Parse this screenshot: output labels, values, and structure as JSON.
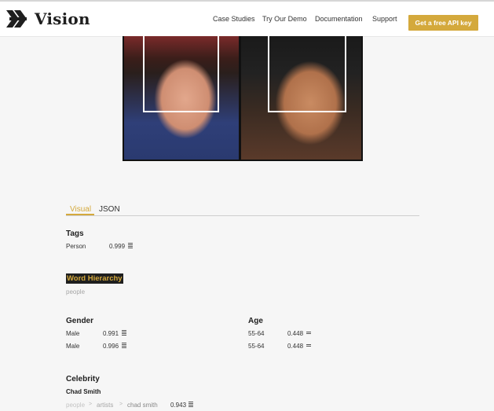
{
  "brand": {
    "name": "Vision"
  },
  "nav": {
    "links": [
      "Case Studies",
      "Try Our Demo",
      "Documentation",
      "Support"
    ],
    "cta": "Get a free API key"
  },
  "result_tabs": {
    "visual": "Visual",
    "json": "JSON"
  },
  "tags": {
    "title": "Tags",
    "items": [
      {
        "label": "Person",
        "score": "0.999"
      }
    ]
  },
  "word_hierarchy": {
    "title": "Word Hierarchy",
    "items": [
      "people"
    ]
  },
  "gender": {
    "title": "Gender",
    "items": [
      {
        "label": "Male",
        "score": "0.991"
      },
      {
        "label": "Male",
        "score": "0.996"
      }
    ]
  },
  "age": {
    "title": "Age",
    "items": [
      {
        "label": "55-64",
        "score": "0.448"
      },
      {
        "label": "55-64",
        "score": "0.448"
      }
    ]
  },
  "celebrity": {
    "title": "Celebrity",
    "name": "Chad Smith",
    "path": [
      "people",
      "artists",
      "chad smith"
    ],
    "score": "0.943"
  },
  "colors": {
    "accent": "#d4a93c",
    "text": "#222222",
    "muted": "#a6a6a6"
  }
}
